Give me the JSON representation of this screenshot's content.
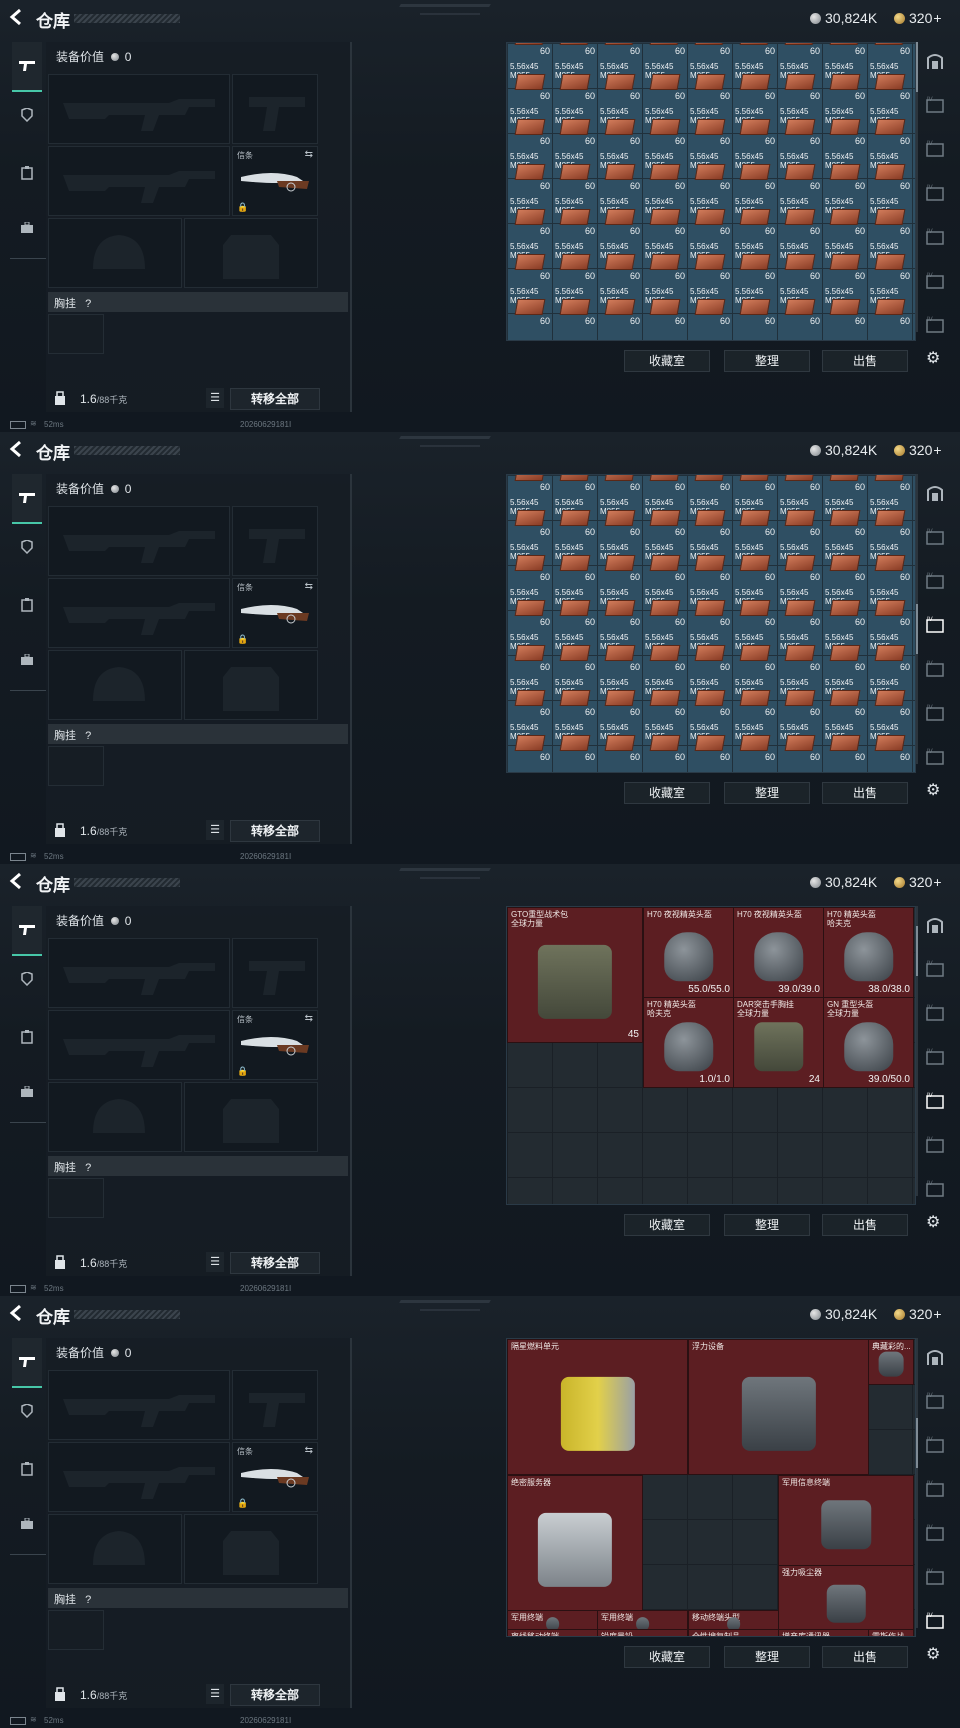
{
  "header": {
    "title": "仓库",
    "silver": "30,824K",
    "gold": "320",
    "gold_plus": "+"
  },
  "loadout": {
    "equip_value_label": "装备价值",
    "equip_value": "0",
    "melee_label": "信条",
    "chest_label": "胸挂",
    "chest_help": "?",
    "weight": "1.6",
    "weight_max": "/88千克",
    "transfer_all": "转移全部"
  },
  "actions": {
    "collection": "收藏室",
    "sort": "整理",
    "sell": "出售"
  },
  "status": {
    "latency": "52ms",
    "build": "20260629181I"
  },
  "ammo": {
    "name_line1": "5.56x45",
    "name_line2": "M855",
    "count": "60"
  },
  "shot3_items": [
    {
      "name": "GTO重型战术包\n全球力量",
      "value": "45"
    },
    {
      "name": "H70 夜视精英头盔",
      "value": "55.0/55.0"
    },
    {
      "name": "H70 夜视精英头盔",
      "value": "39.0/39.0"
    },
    {
      "name": "H70 精英头盔\n哈夫克",
      "value": "38.0/38.0"
    },
    {
      "name": "H70 精英头盔\n哈夫克",
      "value": "1.0/1.0"
    },
    {
      "name": "DAR突击手胸挂\n全球力量",
      "value": "24"
    },
    {
      "name": "GN 重型头盔\n全球力量",
      "value": "39.0/50.0"
    }
  ],
  "shot4_items": [
    {
      "name": "隔星燃料单元"
    },
    {
      "name": "浮力设备"
    },
    {
      "name": "典藏彩的..."
    },
    {
      "name": "绝密服务器"
    },
    {
      "name": "军用信息终端"
    },
    {
      "name": "强力吸尘器"
    },
    {
      "name": "军用终端"
    },
    {
      "name": "军用终端"
    },
    {
      "name": "移动终端头型"
    },
    {
      "name": "离线移动终端"
    },
    {
      "name": "锐度量铅"
    },
    {
      "name": "全性搜复制品"
    },
    {
      "name": "增产库通讯器"
    },
    {
      "name": "雷斯作战"
    }
  ],
  "colors": {
    "accent": "#47c7a8",
    "ammo_bg": "#2f4f63",
    "item_red": "#5c1e22"
  }
}
